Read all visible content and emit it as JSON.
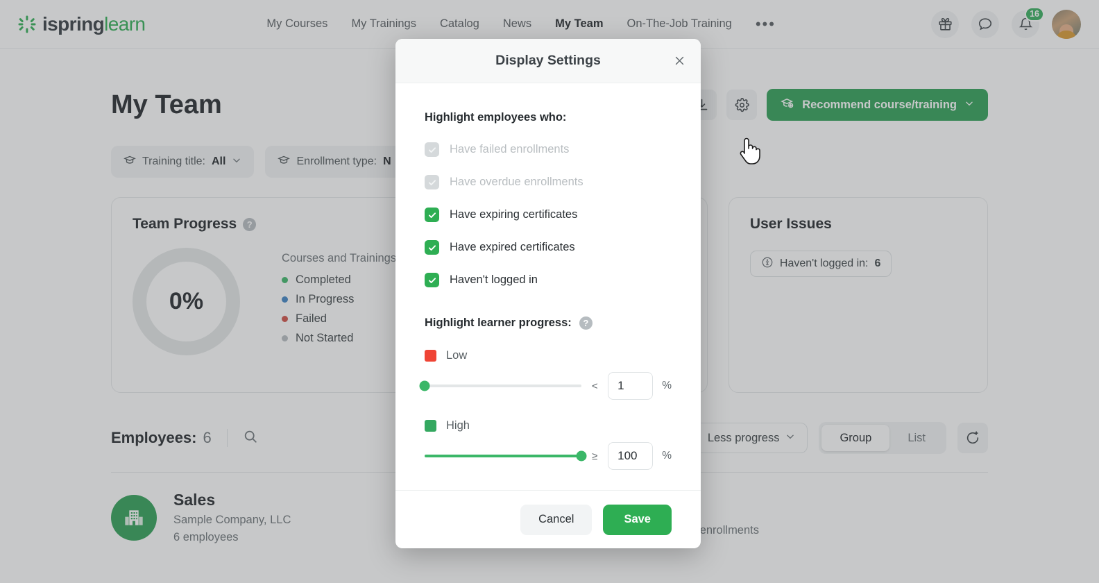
{
  "header": {
    "logo": {
      "name": "ispring",
      "suffix": "learn",
      "icon": "ispring-logo-icon"
    },
    "nav": [
      {
        "label": "My Courses",
        "active": false
      },
      {
        "label": "My Trainings",
        "active": false
      },
      {
        "label": "Catalog",
        "active": false
      },
      {
        "label": "News",
        "active": false
      },
      {
        "label": "My Team",
        "active": true
      },
      {
        "label": "On-The-Job Training",
        "active": false
      }
    ],
    "more_label": "•••",
    "icons": [
      {
        "name": "gift-icon"
      },
      {
        "name": "chat-icon"
      },
      {
        "name": "bell-icon",
        "badge": "16"
      }
    ],
    "avatar": "user-avatar"
  },
  "page": {
    "title": "My Team",
    "actions": {
      "download_icon": "download-icon",
      "settings_icon": "gear-icon",
      "recommend_label": "Recommend course/training",
      "recommend_icon": "graduation-cap-plus-icon",
      "recommend_chevron": "chevron-down-icon"
    },
    "filters": [
      {
        "icon": "graduation-cap-icon",
        "label": "Training title:",
        "value": "All",
        "chevron": "chevron-down-icon"
      },
      {
        "icon": "graduation-cap-icon",
        "label": "Enrollment type:",
        "value": "N",
        "chevron": "chevron-down-icon"
      }
    ]
  },
  "team_progress": {
    "title": "Team Progress",
    "help_icon": "help-icon",
    "percent": "0%",
    "legend_title": "Courses and Trainings",
    "legend": [
      {
        "label": "Completed",
        "color": "#3bb768"
      },
      {
        "label": "In Progress",
        "color": "#3d82c4"
      },
      {
        "label": "Failed",
        "color": "#cf4c43"
      },
      {
        "label": "Not Started",
        "color": "#b6bcc0"
      }
    ]
  },
  "user_issues": {
    "title": "User Issues",
    "pill": {
      "icon": "user-away-icon",
      "label": "Haven't logged in:",
      "value": "6"
    }
  },
  "employees": {
    "label": "Employees:",
    "count": "6",
    "search_icon": "search-icon",
    "sort": {
      "icon": "sort-icon",
      "label": "Less progress",
      "chevron": "chevron-down-icon"
    },
    "view_modes": [
      {
        "label": "Group",
        "active": true
      },
      {
        "label": "List",
        "active": false
      }
    ],
    "refresh_icon": "reassign-icon",
    "rows": [
      {
        "avatar_icon": "building-icon",
        "name": "Sales",
        "company": "Sample Company, LLC",
        "count": "6 employees",
        "progress": "—",
        "status": "No enrollments"
      }
    ]
  },
  "modal": {
    "title": "Display Settings",
    "close_icon": "close-icon",
    "section_employees_title": "Highlight employees who:",
    "checkboxes": [
      {
        "label": "Have failed enrollments",
        "checked": true,
        "disabled": true
      },
      {
        "label": "Have overdue enrollments",
        "checked": true,
        "disabled": true
      },
      {
        "label": "Have expiring certificates",
        "checked": true,
        "disabled": false
      },
      {
        "label": "Have expired certificates",
        "checked": true,
        "disabled": false
      },
      {
        "label": "Haven't logged in",
        "checked": true,
        "disabled": false
      }
    ],
    "section_progress_title": "Highlight learner progress:",
    "section_progress_help_icon": "help-icon",
    "sliders": [
      {
        "swatch_label": "Low",
        "swatch_color": "#ef4435",
        "operator": "<",
        "value": "1",
        "unit": "%",
        "position_pct": 0
      },
      {
        "swatch_label": "High",
        "swatch_color": "#34a860",
        "operator": "≥",
        "value": "100",
        "unit": "%",
        "position_pct": 100
      }
    ],
    "cancel_label": "Cancel",
    "save_label": "Save"
  },
  "colors": {
    "brand_green": "#2eae53",
    "button_green": "#2c9e54",
    "low_red": "#ef4435",
    "badge_green": "#34ad5b"
  }
}
